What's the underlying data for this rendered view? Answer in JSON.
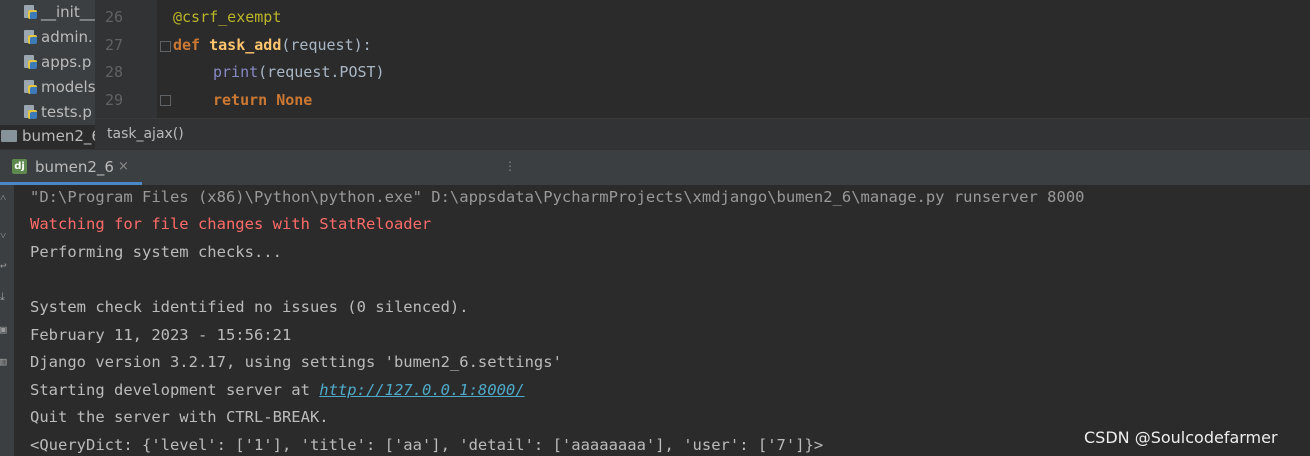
{
  "project_tree": {
    "files": [
      "__init__",
      "admin.",
      "apps.p",
      "models",
      "tests.p"
    ],
    "folder": "bumen2_6"
  },
  "editor": {
    "lines": [
      {
        "num": "26",
        "text": "@csrf_exempt"
      },
      {
        "num": "27",
        "kw": "def ",
        "fn": "task_add",
        "rest": "(request):"
      },
      {
        "num": "28",
        "builtin": "print",
        "rest": "(request.POST)"
      },
      {
        "num": "29",
        "kw": "return None"
      }
    ]
  },
  "breadcrumb": "task_ajax()",
  "run_tab": {
    "icon": "dj",
    "label": "bumen2_6",
    "close": "×",
    "dots": "⋮"
  },
  "console": {
    "lines": [
      "\"D:\\Program Files (x86)\\Python\\python.exe\" D:\\appsdata\\PycharmProjects\\xmdjango\\bumen2_6\\manage.py runserver 8000",
      "Watching for file changes with StatReloader",
      "Performing system checks...",
      "",
      "System check identified no issues (0 silenced).",
      "February 11, 2023 - 15:56:21",
      "Django version 3.2.17, using settings 'bumen2_6.settings'",
      "Quit the server with CTRL-BREAK.",
      "<QueryDict: {'level': ['1'], 'title': ['aa'], 'detail': ['aaaaaaaa'], 'user': ['7']}>"
    ],
    "server_prefix": "Starting development server at ",
    "server_url": "http://127.0.0.1:8000/"
  },
  "watermark": "CSDN @Soulcodefarmer"
}
